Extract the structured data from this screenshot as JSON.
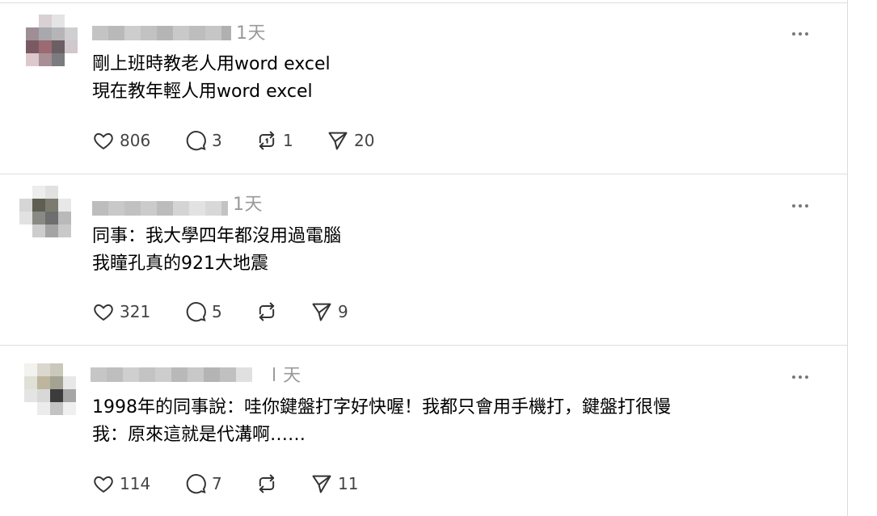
{
  "posts": [
    {
      "time": "1天",
      "lines": [
        "剛上班時教老人用word excel",
        "現在教年輕人用word excel"
      ],
      "likes": "806",
      "comments": "3",
      "reposts": "1",
      "shares": "20"
    },
    {
      "time": "1天",
      "lines": [
        "同事：我大學四年都沒用過電腦",
        "我瞳孔真的921大地震"
      ],
      "likes": "321",
      "comments": "5",
      "reposts": "",
      "shares": "9"
    },
    {
      "time": "l 天",
      "lines": [
        "1998年的同事說：哇你鍵盤打字好快喔！我都只會用手機打，鍵盤打很慢",
        "我：原來這就是代溝啊……"
      ],
      "likes": "114",
      "comments": "7",
      "reposts": "",
      "shares": "11"
    }
  ],
  "icons": {
    "more": "more-horizontal-icon",
    "like": "heart-icon",
    "comment": "comment-bubble-icon",
    "repost": "repost-icon",
    "share": "send-icon"
  },
  "colors": {
    "divider": "#dedede",
    "time": "#999999",
    "icon": "#333333"
  }
}
